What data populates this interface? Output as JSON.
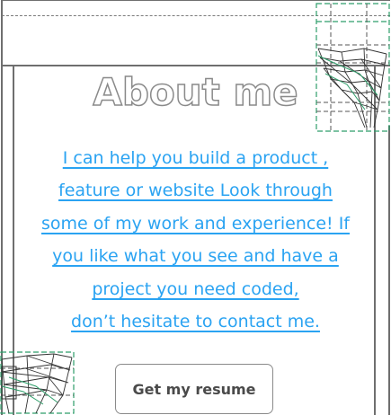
{
  "about": {
    "title": "About me",
    "lines": [
      "I can help you build a product ,",
      "feature or website Look through",
      "some of my work and experience! If",
      "you like what you see and have a",
      "project you need coded,",
      "don’t hesitate to contact me."
    ]
  },
  "actions": {
    "resume_label": "Get my resume"
  },
  "colors": {
    "accent_text": "#2aa3f2",
    "outline_gray": "#8a8a8a",
    "wireframe_green": "#2e9e6a"
  },
  "icons": {
    "top_right": "wireframe-mesh-icon",
    "bottom_left": "wireframe-mesh-icon"
  }
}
